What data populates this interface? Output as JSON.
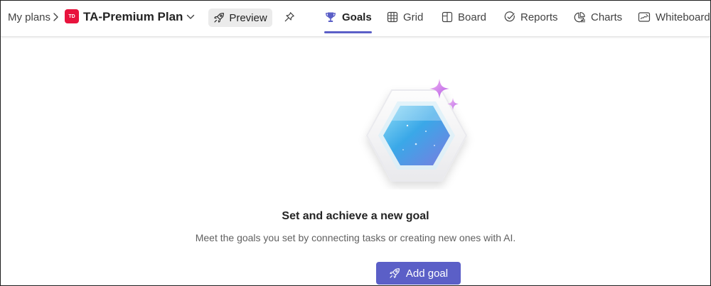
{
  "breadcrumb": {
    "root": "My plans"
  },
  "plan": {
    "badge": "TD",
    "title": "TA-Premium Plan",
    "badge_color": "#e8133d"
  },
  "toolbar": {
    "preview_label": "Preview"
  },
  "tabs": [
    {
      "label": "Goals",
      "icon": "trophy-icon",
      "active": true
    },
    {
      "label": "Grid",
      "icon": "grid-icon"
    },
    {
      "label": "Board",
      "icon": "board-icon"
    },
    {
      "label": "Reports",
      "icon": "reports-icon"
    },
    {
      "label": "Charts",
      "icon": "charts-icon"
    },
    {
      "label": "Whiteboard",
      "icon": "whiteboard-icon"
    }
  ],
  "empty_state": {
    "title": "Set and achieve a new goal",
    "description": "Meet the goals you set by connecting tasks or creating new ones with AI.",
    "button_label": "Add goal",
    "illustration": "hexagon-gem-illustration"
  },
  "colors": {
    "accent": "#5b5fc7",
    "text": "#242424",
    "muted": "#616161"
  }
}
